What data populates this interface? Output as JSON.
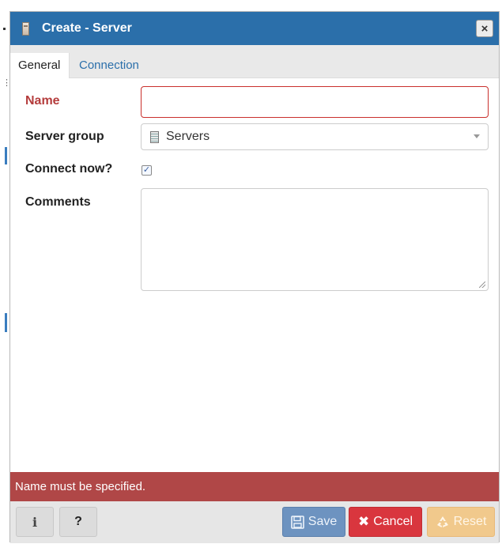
{
  "dialog": {
    "title": "Create - Server",
    "close_label": "×"
  },
  "tabs": [
    {
      "label": "General"
    },
    {
      "label": "Connection"
    }
  ],
  "form": {
    "name_label": "Name",
    "name_value": "",
    "server_group_label": "Server group",
    "server_group_value": "Servers",
    "connect_now_label": "Connect now?",
    "connect_now_checked": true,
    "comments_label": "Comments",
    "comments_value": ""
  },
  "error_message": "Name must be specified.",
  "footer": {
    "info_label": "i",
    "help_label": "?",
    "save_label": "Save",
    "cancel_label": "Cancel",
    "reset_label": "Reset"
  },
  "icons": {
    "title": "server-icon",
    "server_group": "server-group-icon",
    "save": "floppy-disk-icon",
    "cancel": "x-icon",
    "reset": "recycle-icon"
  },
  "colors": {
    "titlebar": "#2b6faa",
    "error": "#b04747",
    "cancel": "#d9363e",
    "save": "#6d93c0",
    "reset": "#f1c98c"
  }
}
